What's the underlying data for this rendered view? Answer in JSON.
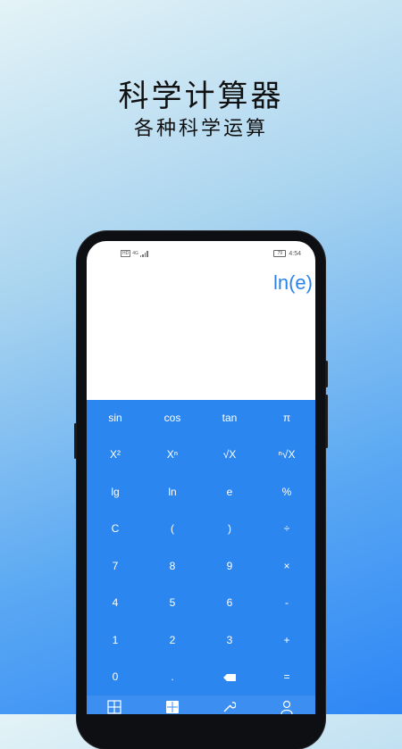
{
  "hero": {
    "title": "科学计算器",
    "subtitle": "各种科学运算"
  },
  "status_bar": {
    "left_badge": "HD",
    "network": "4G",
    "battery": "79",
    "time": "4:54"
  },
  "display": {
    "expression": "ln(e)"
  },
  "keys": [
    [
      "sin",
      "cos",
      "tan",
      "π"
    ],
    [
      "X²",
      "Xⁿ",
      "√X",
      "ⁿ√X"
    ],
    [
      "lg",
      "ln",
      "e",
      "%"
    ],
    [
      "C",
      "(",
      ")",
      "÷"
    ],
    [
      "7",
      "8",
      "9",
      "×"
    ],
    [
      "4",
      "5",
      "6",
      "-"
    ],
    [
      "1",
      "2",
      "3",
      "+"
    ],
    [
      "0",
      ".",
      "",
      "="
    ]
  ],
  "icons": {
    "backspace": "backspace-icon",
    "tabs": [
      "calculator-grid-icon",
      "scientific-calc-icon",
      "tools-icon",
      "user-icon"
    ]
  },
  "colors": {
    "accent": "#2b83ea",
    "keypad": "#2c86ef",
    "key_text": "#ffffff"
  }
}
